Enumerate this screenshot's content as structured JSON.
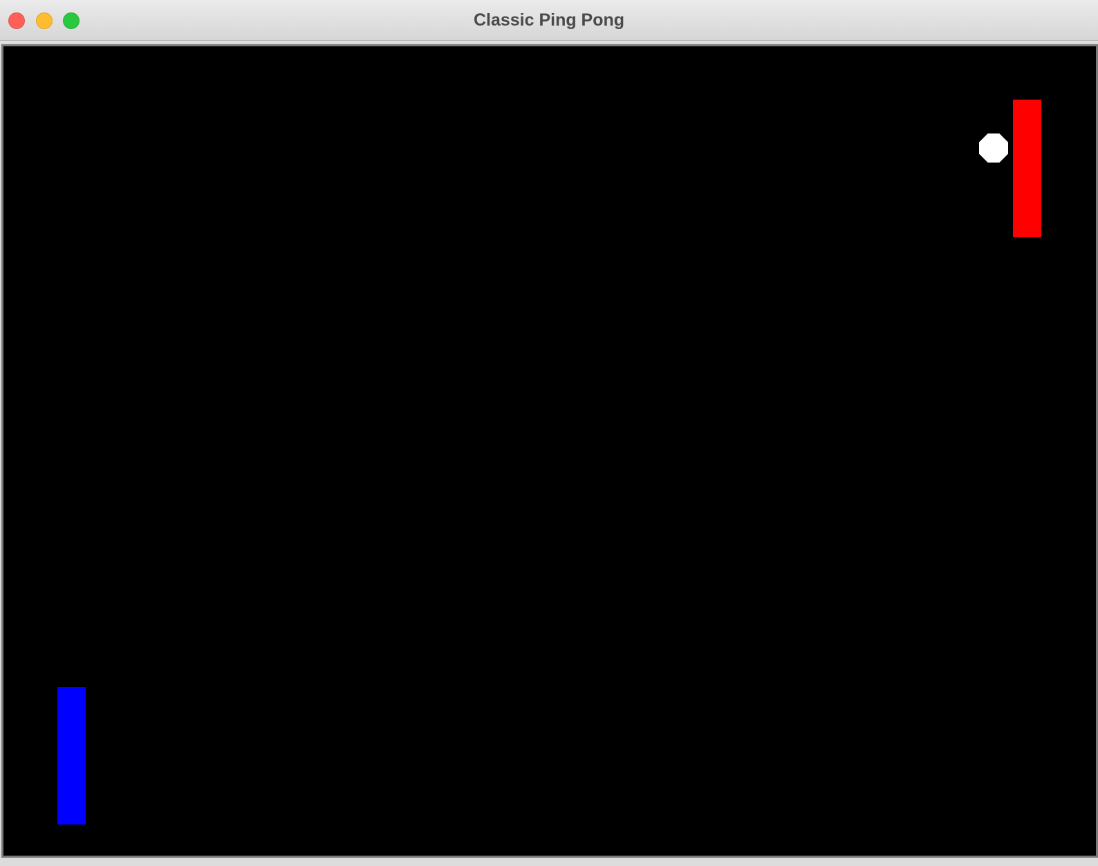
{
  "window": {
    "title": "Classic Ping Pong",
    "buttons": [
      {
        "name": "close",
        "color": "#ff5f57"
      },
      {
        "name": "minimize",
        "color": "#febc2e"
      },
      {
        "name": "zoom",
        "color": "#28c840"
      }
    ]
  },
  "game": {
    "background_color": "#000000",
    "left_paddle": {
      "color": "#0000ff"
    },
    "right_paddle": {
      "color": "#ff0000"
    },
    "ball": {
      "color": "#ffffff"
    }
  }
}
